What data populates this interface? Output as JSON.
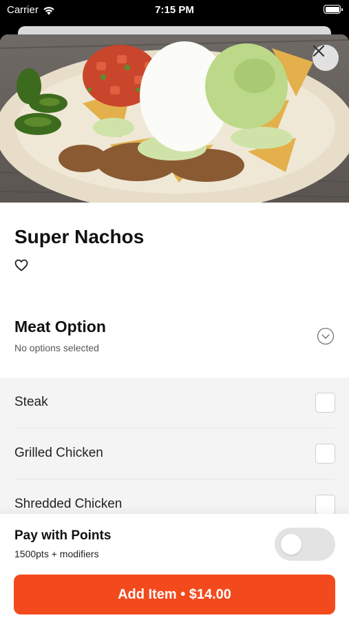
{
  "status": {
    "carrier": "Carrier",
    "time": "7:15 PM"
  },
  "item": {
    "title": "Super Nachos"
  },
  "meat_option": {
    "title": "Meat Option",
    "subtitle": "No options selected",
    "options": [
      {
        "label": "Steak",
        "checked": false
      },
      {
        "label": "Grilled Chicken",
        "checked": false
      },
      {
        "label": "Shredded Chicken",
        "checked": false
      }
    ]
  },
  "points": {
    "title": "Pay with Points",
    "subtitle": "1500pts + modifiers",
    "enabled": false
  },
  "cta": {
    "label": "Add Item • $14.00"
  },
  "colors": {
    "accent": "#f34a1d",
    "toggle_off": "#e3e3e3"
  }
}
